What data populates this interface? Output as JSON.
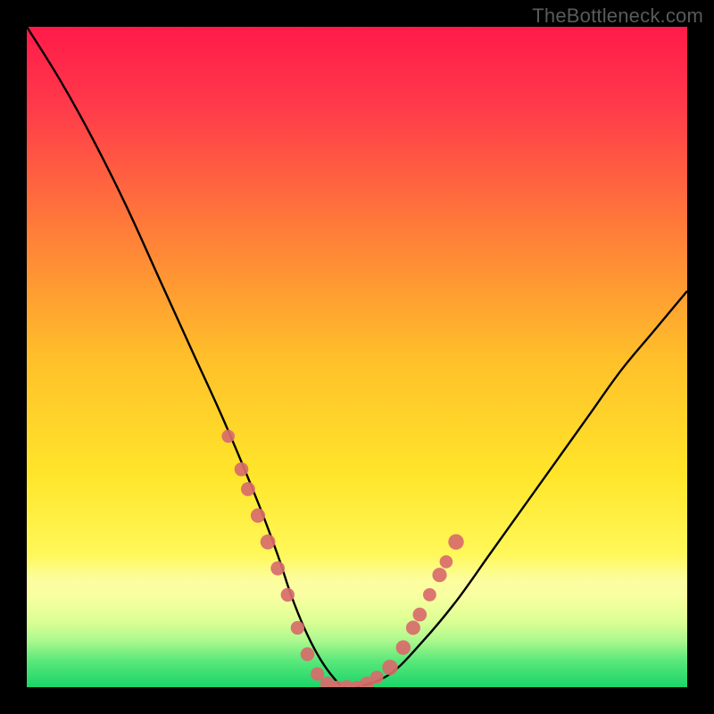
{
  "watermark": "TheBottleneck.com",
  "chart_data": {
    "type": "line",
    "title": "",
    "xlabel": "",
    "ylabel": "",
    "xlim": [
      0,
      100
    ],
    "ylim": [
      0,
      100
    ],
    "series": [
      {
        "name": "bottleneck-curve",
        "x": [
          0,
          5,
          10,
          15,
          20,
          25,
          30,
          35,
          38,
          40,
          42,
          44,
          46,
          48,
          50,
          55,
          60,
          65,
          70,
          75,
          80,
          85,
          90,
          95,
          100
        ],
        "values": [
          100,
          92,
          83,
          73,
          62,
          51,
          40,
          28,
          20,
          14,
          9,
          5,
          2,
          0,
          0,
          2,
          7,
          13,
          20,
          27,
          34,
          41,
          48,
          54,
          60
        ]
      }
    ],
    "markers": {
      "name": "highlight-dots",
      "color": "#d86b6b",
      "points": [
        {
          "x": 30.5,
          "y": 38
        },
        {
          "x": 32.5,
          "y": 33
        },
        {
          "x": 33.5,
          "y": 30
        },
        {
          "x": 35.0,
          "y": 26
        },
        {
          "x": 36.5,
          "y": 22
        },
        {
          "x": 38.0,
          "y": 18
        },
        {
          "x": 39.5,
          "y": 14
        },
        {
          "x": 41.0,
          "y": 9
        },
        {
          "x": 42.5,
          "y": 5
        },
        {
          "x": 44.0,
          "y": 2
        },
        {
          "x": 45.5,
          "y": 0.5
        },
        {
          "x": 47.0,
          "y": 0
        },
        {
          "x": 48.5,
          "y": 0
        },
        {
          "x": 50.0,
          "y": 0
        },
        {
          "x": 51.5,
          "y": 0.5
        },
        {
          "x": 53.0,
          "y": 1.5
        },
        {
          "x": 55.0,
          "y": 3
        },
        {
          "x": 57.0,
          "y": 6
        },
        {
          "x": 58.5,
          "y": 9
        },
        {
          "x": 59.5,
          "y": 11
        },
        {
          "x": 61.0,
          "y": 14
        },
        {
          "x": 62.5,
          "y": 17
        },
        {
          "x": 63.5,
          "y": 19
        },
        {
          "x": 65.0,
          "y": 22
        }
      ]
    },
    "gradient": {
      "stops": [
        {
          "offset": 0.0,
          "color": "#ff1a4a"
        },
        {
          "offset": 0.12,
          "color": "#ff3a4a"
        },
        {
          "offset": 0.3,
          "color": "#ff7a3a"
        },
        {
          "offset": 0.5,
          "color": "#ffbf2a"
        },
        {
          "offset": 0.68,
          "color": "#ffe62a"
        },
        {
          "offset": 0.8,
          "color": "#fff85a"
        },
        {
          "offset": 0.86,
          "color": "#f8ff8a"
        },
        {
          "offset": 0.9,
          "color": "#d8ff8a"
        },
        {
          "offset": 0.93,
          "color": "#a8f88a"
        },
        {
          "offset": 0.96,
          "color": "#5ae87a"
        },
        {
          "offset": 1.0,
          "color": "#1ad46a"
        }
      ]
    },
    "band": {
      "top_y_fraction": 0.8,
      "alpha_top": 0.0,
      "alpha_mid": 0.35
    }
  }
}
